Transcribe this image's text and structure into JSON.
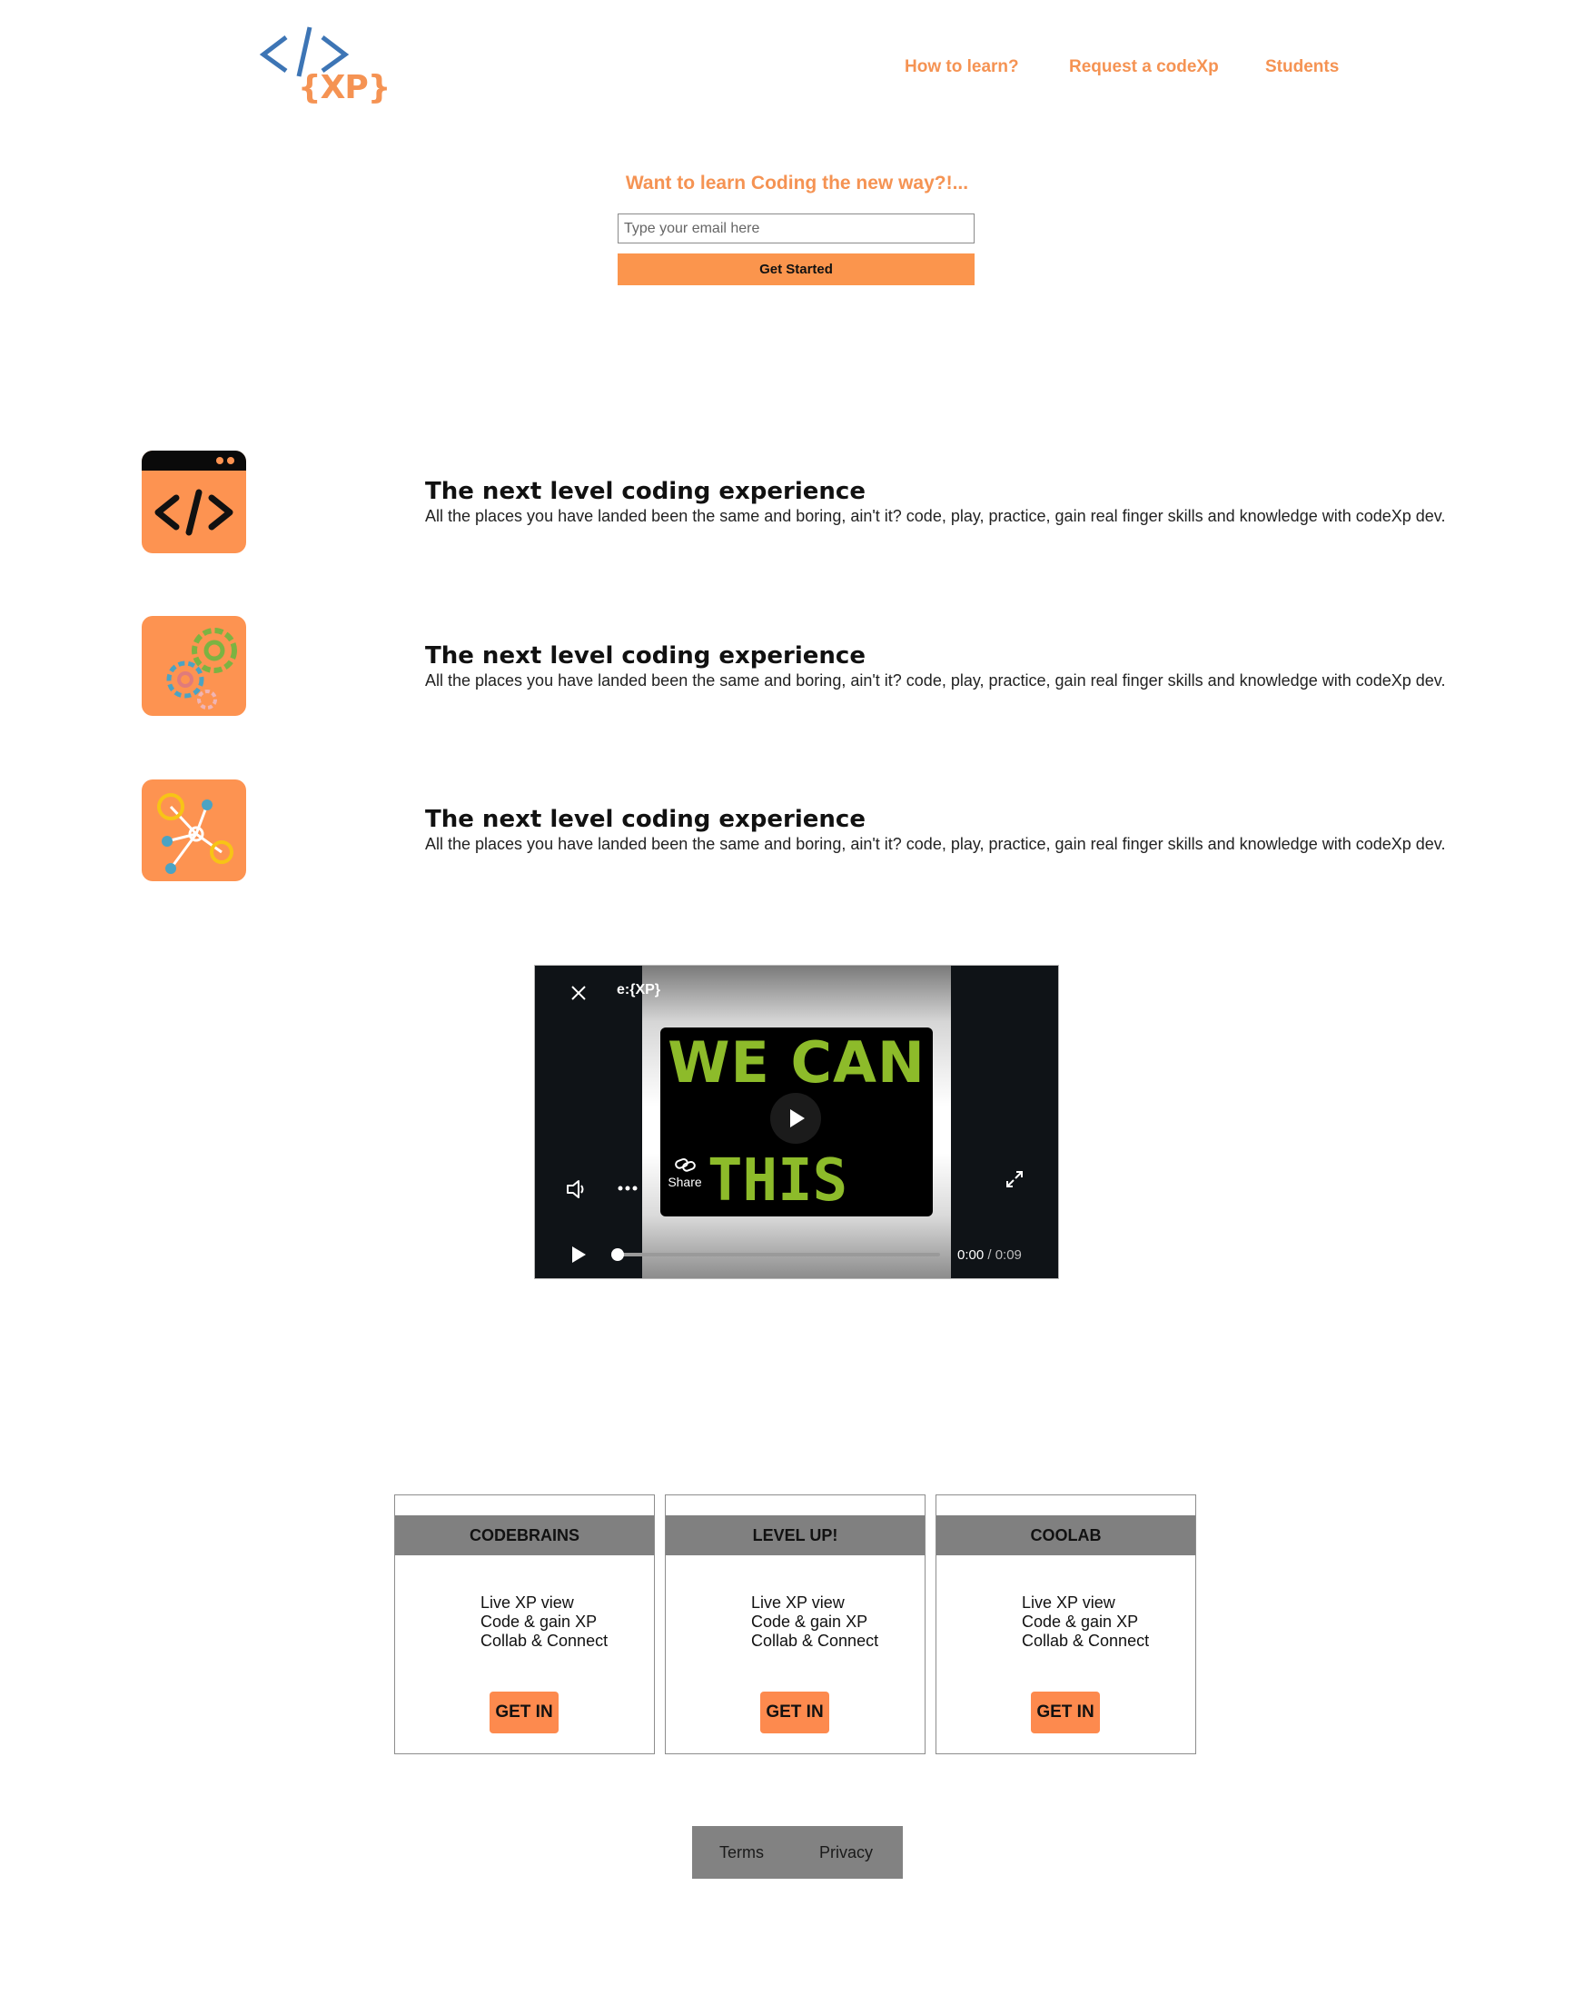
{
  "header": {
    "logo_text": "{XP}",
    "nav": [
      {
        "label": "How to learn?"
      },
      {
        "label": "Request a codeXp"
      },
      {
        "label": "Students"
      }
    ]
  },
  "hero": {
    "question": "Want to learn Coding the new way?!...",
    "email_placeholder": "Type your email here",
    "cta_label": "Get Started"
  },
  "features": [
    {
      "icon": "code-window-icon",
      "title": "The next level coding experience",
      "description": "All the places you have landed been the same and boring, ain't it? code, play, practice, gain real finger skills and knowledge with codeXp dev."
    },
    {
      "icon": "gears-icon",
      "title": "The next level coding experience",
      "description": "All the places you have landed been the same and boring, ain't it? code, play, practice, gain real finger skills and knowledge with codeXp dev."
    },
    {
      "icon": "network-icon",
      "title": "The next level coding experience",
      "description": "All the places you have landed been the same and boring, ain't it? code, play, practice, gain real finger skills and knowledge with codeXp dev."
    }
  ],
  "video": {
    "title": "e:{XP}",
    "screen_line1": "WE CAN",
    "screen_line2": "THIS",
    "share_label": "Share",
    "time_current": "0:00",
    "time_total": "/ 0:09"
  },
  "plans": [
    {
      "name": "CODEBRAINS",
      "features": [
        "Live XP view",
        "Code & gain XP",
        "Collab & Connect"
      ],
      "button": "GET IN"
    },
    {
      "name": "LEVEL UP!",
      "features": [
        "Live XP view",
        "Code & gain XP",
        "Collab & Connect"
      ],
      "button": "GET IN"
    },
    {
      "name": "COOLAB",
      "features": [
        "Live XP view",
        "Code & gain XP",
        "Collab & Connect"
      ],
      "button": "GET IN"
    }
  ],
  "footer": {
    "links": [
      {
        "label": "Terms"
      },
      {
        "label": "Privacy"
      }
    ]
  },
  "colors": {
    "accent": "#f59353",
    "button": "#fb954d",
    "plan_header": "#808080",
    "footer_bg": "#828282",
    "video_text": "#8dbb2a"
  }
}
